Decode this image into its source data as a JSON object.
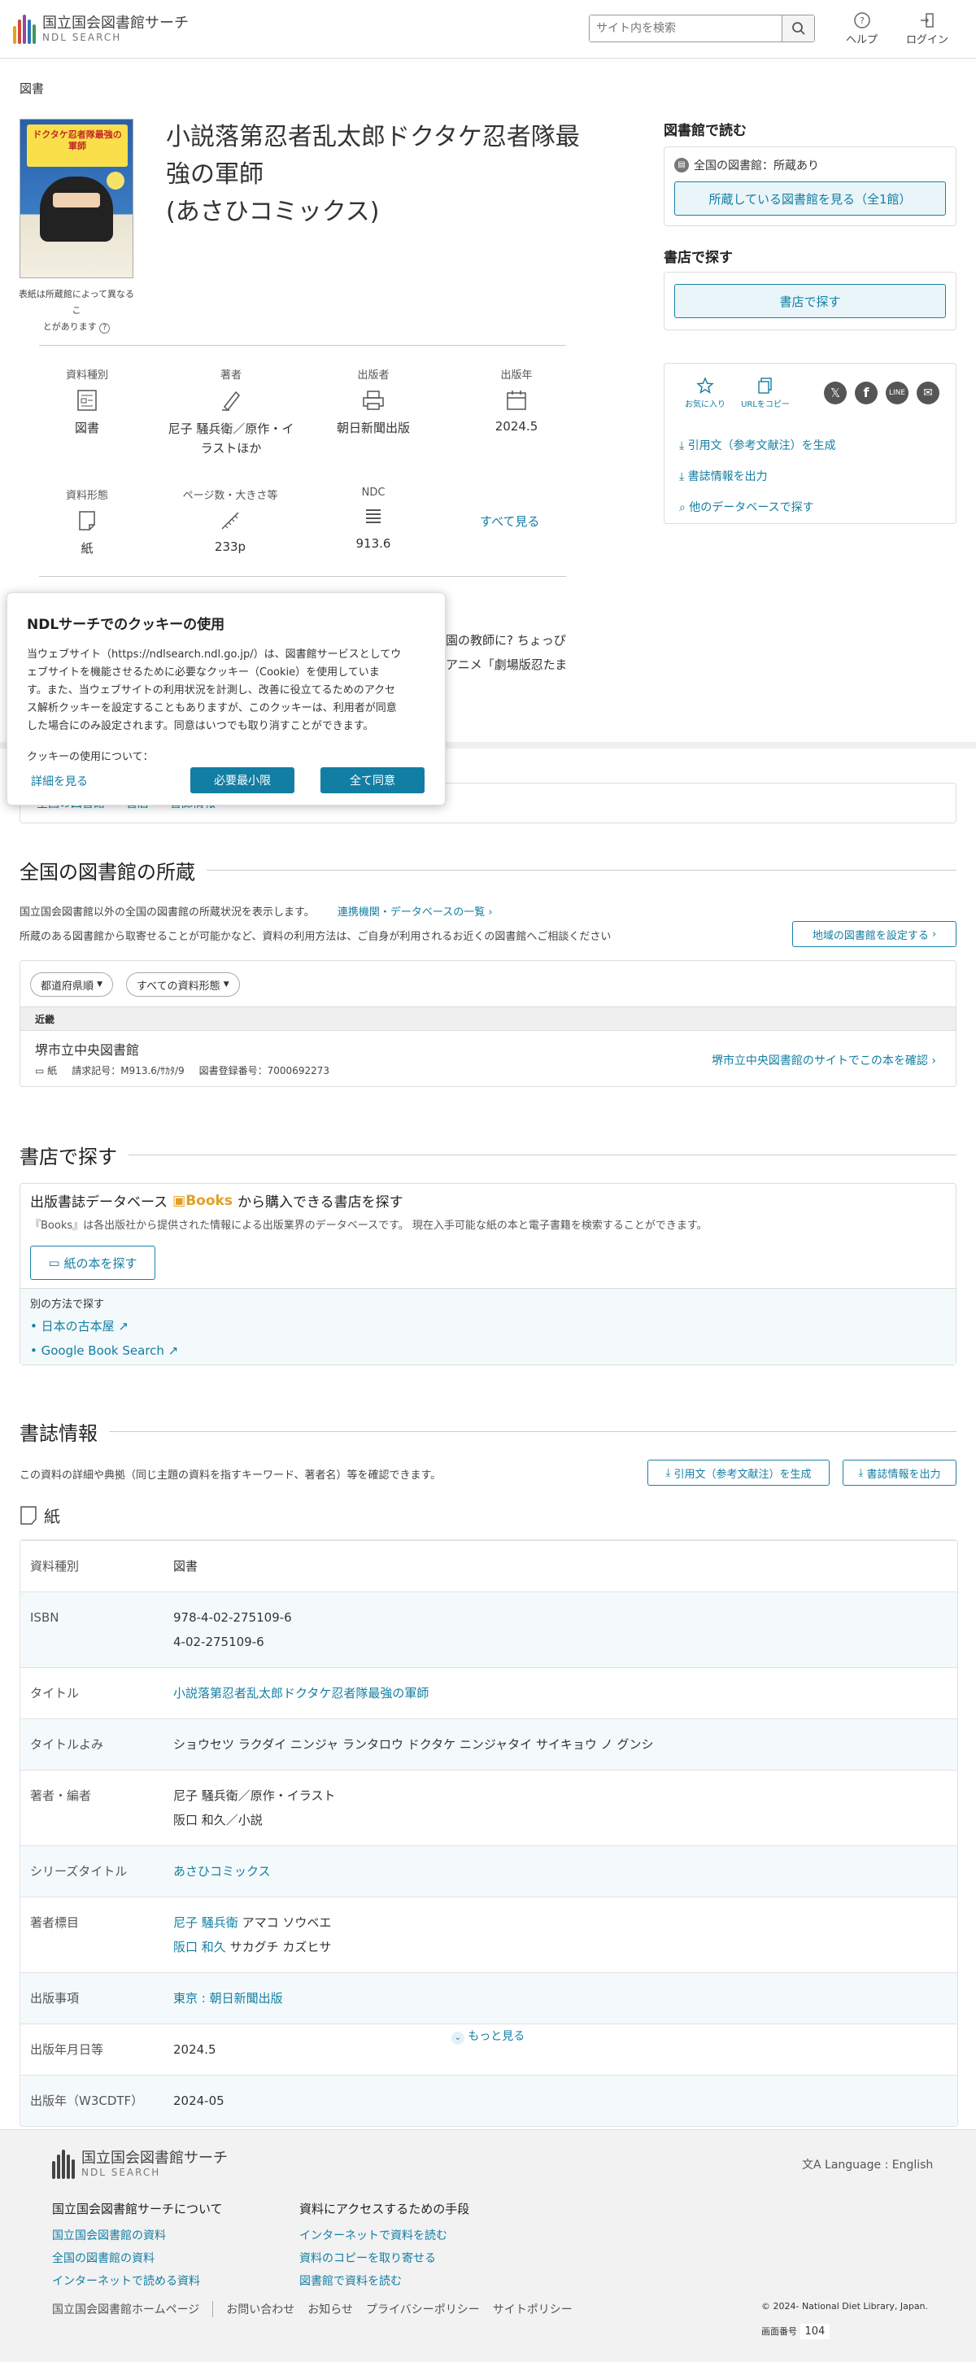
{
  "header": {
    "logo_ja": "国立国会図書館サーチ",
    "logo_en": "NDL SEARCH",
    "search_placeholder": "サイト内を検索",
    "help_label": "ヘルプ",
    "login_label": "ログイン",
    "logo_bar_colors": [
      "#e8a317",
      "#d4483b",
      "#8e4a9d",
      "#2f73b8",
      "#3a9a5b",
      "#e8a317",
      "#2f73b8"
    ]
  },
  "item": {
    "category": "図書",
    "title_line1": "小説落第忍者乱太郎ドクタケ忍者隊最",
    "title_line2": "強の軍師",
    "series_line": "(あさひコミックス)",
    "cover_note1": "表紙は所蔵館によって異なるこ",
    "cover_note2": "とがあります",
    "cover_text": "ドクタケ忍者隊最強の軍師"
  },
  "meta": {
    "type_label": "資料種別",
    "type_value": "図書",
    "author_label": "著者",
    "author_line1": "尼子 騒兵衛／原作・イ",
    "author_line2": "ラストほか",
    "publisher_label": "出版者",
    "publisher_value": "朝日新聞出版",
    "year_label": "出版年",
    "year_value": "2024.5",
    "form_label": "資料形態",
    "form_value": "紙",
    "pages_label": "ページ数・大きさ等",
    "pages_value": "233p",
    "ndc_label": "NDC",
    "ndc_value": "913.6",
    "see_all": "すべて見る"
  },
  "desc": {
    "text1": "園の教師に? ちょっぴ",
    "text2": "アニメ「劇場版忍たま"
  },
  "tabs": [
    "全国の図書館",
    "書店",
    "書誌情報"
  ],
  "right": {
    "library_heading": "図書館で読む",
    "library_status": "全国の図書館：所蔵あり",
    "library_button": "所蔵している図書館を見る（全1館）",
    "shop_heading": "書店で探す",
    "shop_button": "書店で探す",
    "fav_label": "お気に入り",
    "url_label": "URLをコピー",
    "cite_link": "引用文（参考文献注）を生成",
    "export_link": "書誌情報を出力",
    "other_db_link": "他のデータベースで探す"
  },
  "cookie": {
    "title": "NDLサーチでのクッキーの使用",
    "line1": "当ウェブサイト（https://ndlsearch.ndl.go.jp/）は、図書館サービスとしてウ",
    "line2": "ェブサイトを機能させるために必要なクッキー（Cookie）を使用していま",
    "line3": "す。また、当ウェブサイトの利用状況を計測し、改善に役立てるためのアクセ",
    "line4": "ス解析クッキーを設定することもありますが、このクッキーは、利用者が同意",
    "line5": "した場合にのみ設定されます。同意はいつでも取り消すことができます。",
    "usage": "クッキーの使用について：",
    "details": "詳細を見る",
    "minimum": "必要最小限",
    "accept_all": "全て同意"
  },
  "holdings": {
    "heading": "全国の図書館の所蔵",
    "desc1": "国立国会図書館以外の全国の図書館の所蔵状況を表示します。",
    "partner_link": "連携機関・データベースの一覧",
    "desc2": "所蔵のある図書館から取寄せることが可能かなど、資料の利用方法は、ご自身が利用されるお近くの図書館へご相談ください",
    "region_button": "地域の図書館を設定する",
    "filter_pref": "都道府県順",
    "filter_type": "すべての資料形態",
    "region": "近畿",
    "library_name": "堺市立中央図書館",
    "form": "紙",
    "callno_label": "請求記号：",
    "callno": "M913.6/ｻｶﾀ/9",
    "regno_label": "図書登録番号：",
    "regno": "7000692273",
    "library_link": "堺市立中央図書館のサイトでこの本を確認"
  },
  "bookstore": {
    "heading": "書店で探す",
    "db_prefix": "出版書誌データベース",
    "books_logo": "Books",
    "db_suffix": "から購入できる書店を探す",
    "desc": "『Books』は各出版社から提供された情報による出版業界のデータベースです。 現在入手可能な紙の本と電子書籍を検索することができます。",
    "paper_button": "紙の本を探す",
    "other_label": "別の方法で探す",
    "link1": "日本の古本屋",
    "link2": "Google Book Search"
  },
  "bib": {
    "heading": "書誌情報",
    "desc": "この資料の詳細や典拠（同じ主題の資料を指すキーワード、著者名）等を確認できます。",
    "cite_button": "引用文（参考文献注）を生成",
    "export_button": "書誌情報を出力",
    "form_title": "紙",
    "rows": {
      "type_k": "資料種別",
      "type_v": "図書",
      "isbn_k": "ISBN",
      "isbn_v1": "978-4-02-275109-6",
      "isbn_v2": "4-02-275109-6",
      "title_k": "タイトル",
      "title_v": "小説落第忍者乱太郎ドクタケ忍者隊最強の軍師",
      "reading_k": "タイトルよみ",
      "reading_v": "ショウセツ ラクダイ ニンジャ ランタロウ ドクタケ ニンジャタイ サイキョウ ノ グンシ",
      "author_k": "著者・編者",
      "author_v1": "尼子 騒兵衛／原作・イラスト",
      "author_v2": "阪口 和久／小説",
      "series_k": "シリーズタイトル",
      "series_v": "あさひコミックス",
      "heading_k": "著者標目",
      "heading_v1_name": "尼子 騒兵衛",
      "heading_v1_read": "アマコ ソウベエ",
      "heading_v2_name": "阪口 和久",
      "heading_v2_read": "サカグチ カズヒサ",
      "pub_k": "出版事項",
      "pub_v": "東京 : 朝日新聞出版",
      "date_k": "出版年月日等",
      "date_v": "2024.5",
      "w3_k": "出版年（W3CDTF）",
      "w3_v": "2024-05"
    },
    "more": "もっと見る"
  },
  "footer": {
    "logo_ja": "国立国会図書館サーチ",
    "logo_en": "NDL SEARCH",
    "language": "Language : English",
    "about_heading": "国立国会図書館サーチについて",
    "about_links": [
      "国立国会図書館の資料",
      "全国の図書館の資料",
      "インターネットで読める資料"
    ],
    "access_heading": "資料にアクセスするための手段",
    "access_links": [
      "インターネットで資料を読む",
      "資料のコピーを取り寄せる",
      "図書館で資料を読む"
    ],
    "bottom_links": [
      "国立国会図書館ホームページ",
      "お問い合わせ",
      "お知らせ",
      "プライバシーポリシー",
      "サイトポリシー"
    ],
    "copyright": "© 2024- National Diet Library, Japan.",
    "screen_label": "画面番号",
    "screen_no": "104"
  }
}
